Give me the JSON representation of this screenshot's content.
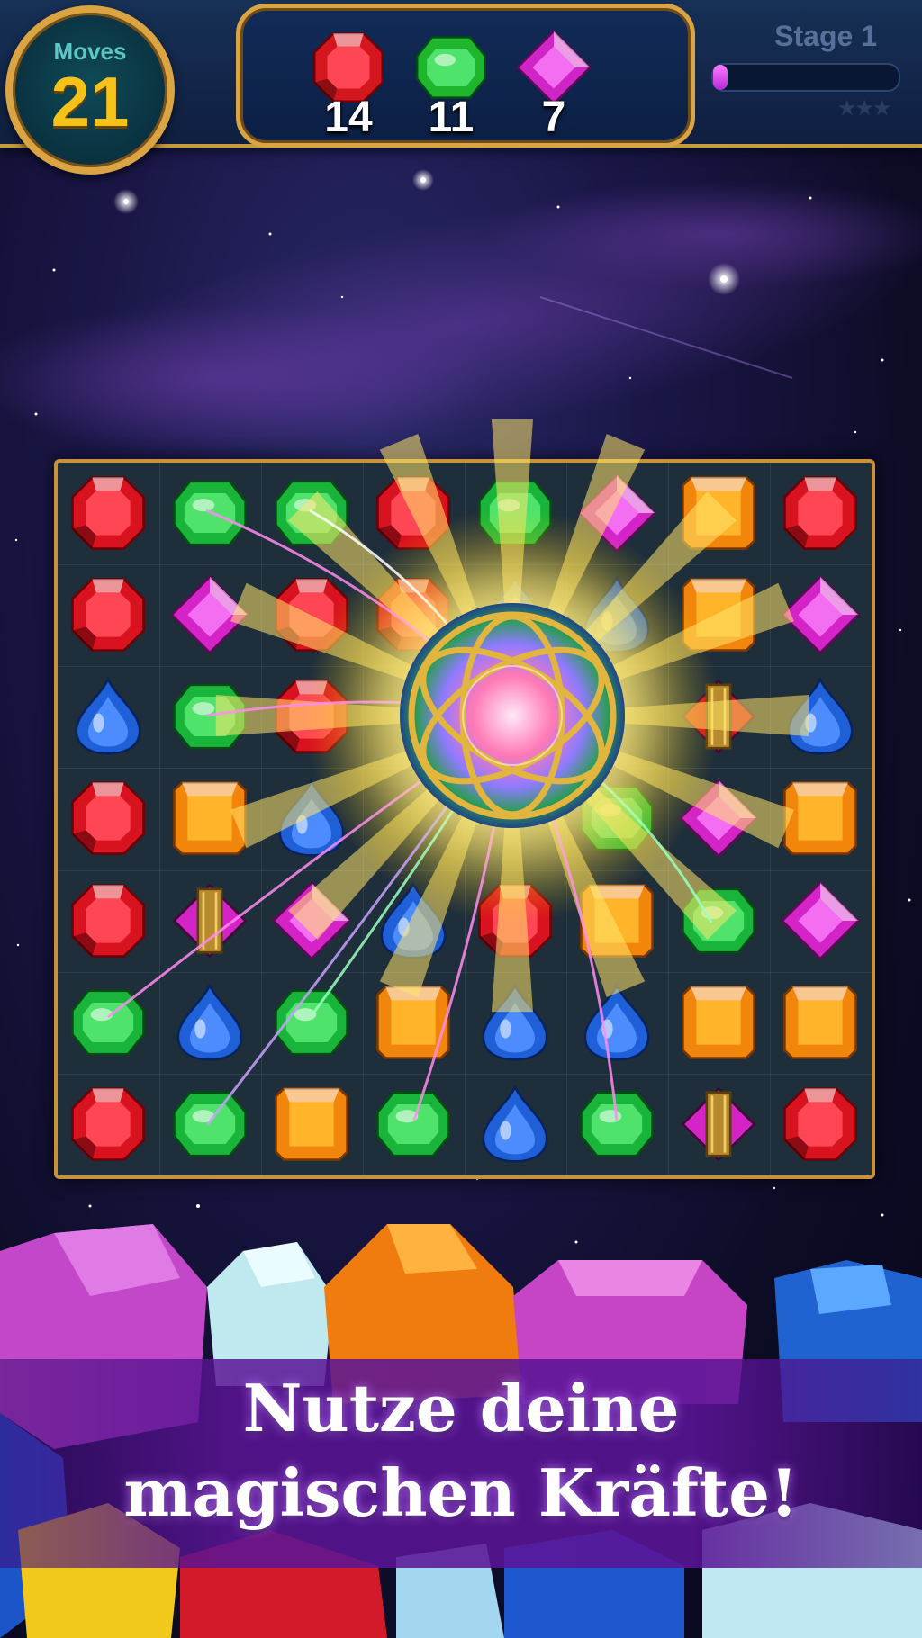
{
  "hud": {
    "moves_label": "Moves",
    "moves_value": "21",
    "goals": [
      {
        "gem": "red-gem",
        "count": "14",
        "color": "#d4171f"
      },
      {
        "gem": "green-gem",
        "count": "11",
        "color": "#1fb52c"
      },
      {
        "gem": "purple-gem",
        "count": "7",
        "color": "#d025c6"
      }
    ],
    "stage_label": "Stage 1",
    "progress": 0.08,
    "stars_earned": 0,
    "stars_total": 3
  },
  "board": {
    "rows": [
      [
        "red",
        "green",
        "green",
        "red",
        "green",
        "purple",
        "orange",
        "red"
      ],
      [
        "red",
        "purple",
        "red",
        "red",
        "blue",
        "blue",
        "orange",
        "purple"
      ],
      [
        "blue",
        "green",
        "red",
        "orb",
        "orb",
        "orb",
        "red-bomb",
        "blue"
      ],
      [
        "red",
        "orange",
        "blue",
        "orb",
        "orb",
        "green",
        "purple",
        "orange"
      ],
      [
        "red",
        "purple-bomb",
        "purple",
        "blue",
        "red",
        "orange",
        "green",
        "purple"
      ],
      [
        "green",
        "blue",
        "green",
        "orange",
        "blue",
        "blue",
        "orange",
        "orange"
      ],
      [
        "red",
        "green",
        "orange",
        "green",
        "blue",
        "green",
        "purple-bomb",
        "red"
      ]
    ],
    "gem_colors": {
      "red": "#d8121e",
      "green": "#19b43a",
      "blue": "#1f5fd8",
      "purple": "#d424c8",
      "orange": "#f2860c"
    },
    "special": "rainbow-orb"
  },
  "banner": {
    "line1": "Nutze deine",
    "line2": "magischen Kräfte!"
  }
}
